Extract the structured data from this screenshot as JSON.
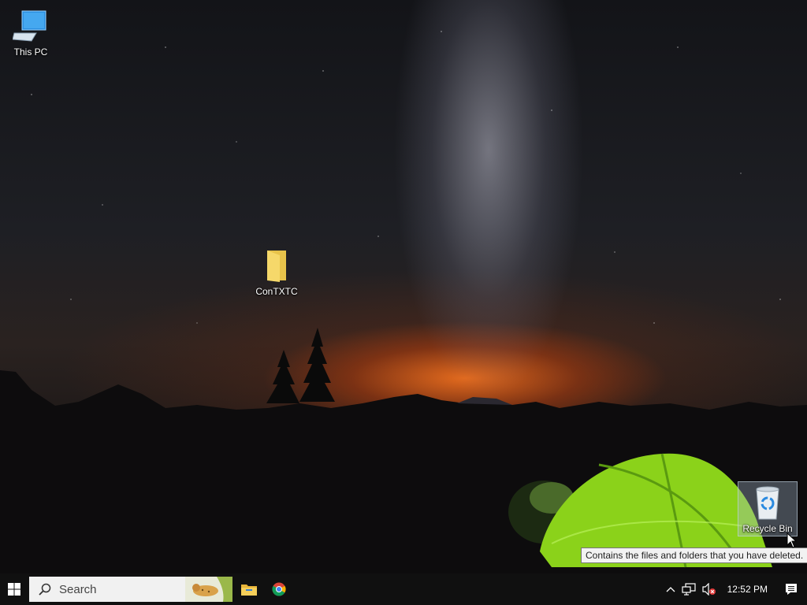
{
  "desktop": {
    "icons": [
      {
        "label": "This PC",
        "icon": "computer-icon"
      },
      {
        "label": "ConTXTC",
        "icon": "folder-icon"
      },
      {
        "label": "Recycle Bin",
        "icon": "recycle-bin-icon"
      }
    ],
    "tooltip": "Contains the files and folders that you have deleted."
  },
  "taskbar": {
    "search_placeholder": "Search",
    "pinned": [
      {
        "icon": "file-explorer-icon"
      },
      {
        "icon": "chrome-icon"
      }
    ],
    "tray": {
      "clock": "12:52 PM",
      "icons": [
        "chevron-up-icon",
        "network-icon",
        "volume-muted-icon",
        "action-center-icon"
      ]
    }
  },
  "colors": {
    "taskbar_bg": "#101010",
    "tent_green": "#8bd21a",
    "horizon_orange": "#eb6e1e"
  }
}
